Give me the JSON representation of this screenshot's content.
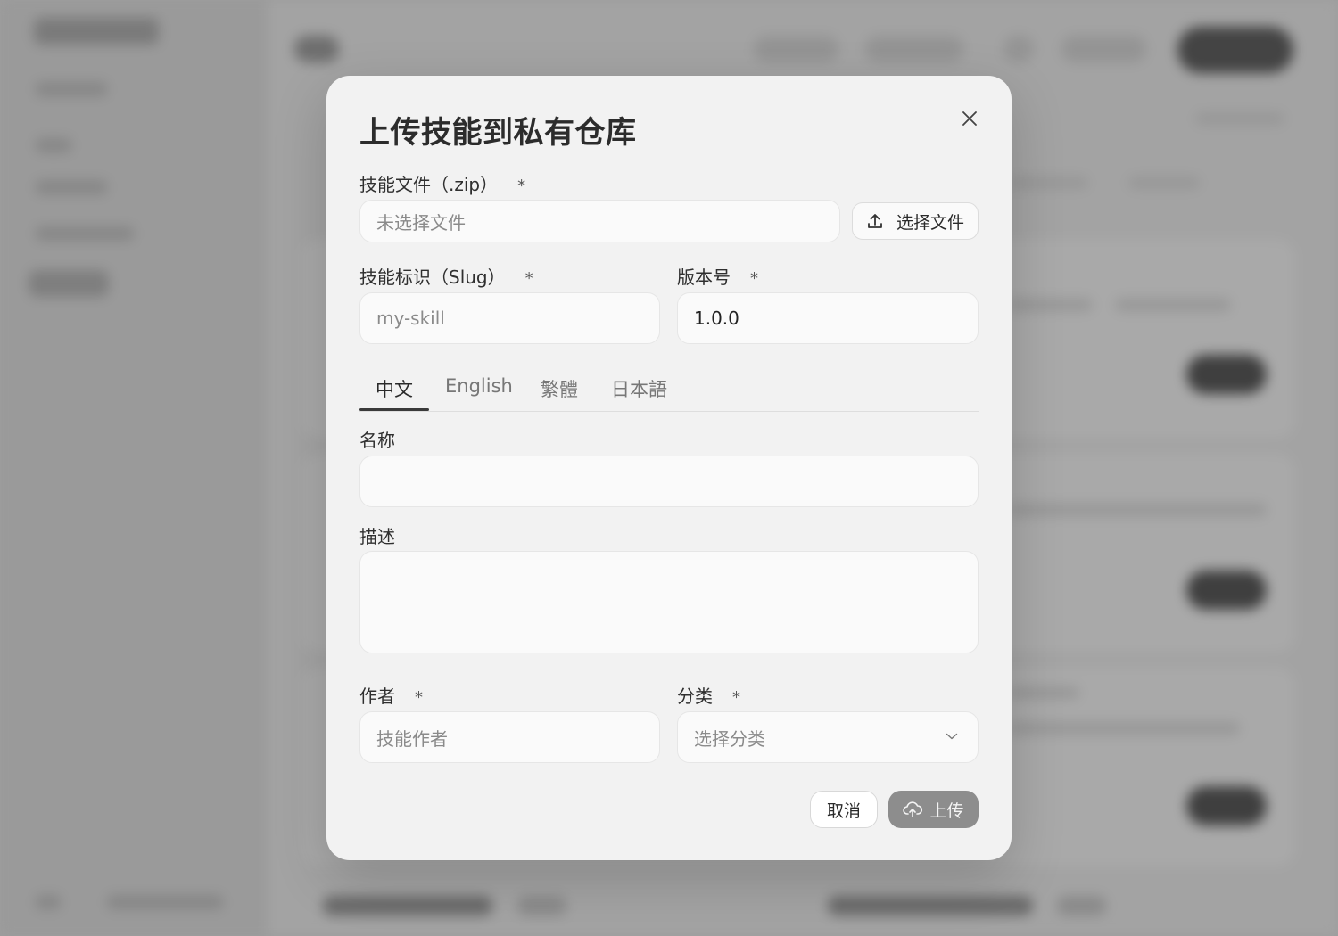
{
  "modal": {
    "title": "上传技能到私有仓库",
    "required_mark": "*",
    "file": {
      "label": "技能文件（.zip）",
      "placeholder": "未选择文件",
      "button_label": "选择文件"
    },
    "slug": {
      "label": "技能标识（Slug）",
      "placeholder": "my-skill"
    },
    "version": {
      "label": "版本号",
      "value": "1.0.0"
    },
    "tabs": [
      {
        "label": "中文"
      },
      {
        "label": "English"
      },
      {
        "label": "繁體"
      },
      {
        "label": "日本語"
      }
    ],
    "active_tab": "中文",
    "name": {
      "label": "名称",
      "value": ""
    },
    "description": {
      "label": "描述",
      "value": ""
    },
    "author": {
      "label": "作者",
      "placeholder": "技能作者"
    },
    "category": {
      "label": "分类",
      "placeholder": "选择分类"
    },
    "actions": {
      "cancel_label": "取消",
      "upload_label": "上传"
    }
  },
  "icons": {
    "close": "close-icon",
    "upload_file": "upload-icon",
    "chevron": "chevron-down-icon",
    "cloud_upload": "cloud-upload-icon"
  },
  "colors": {
    "overlay": "#9d9d9d",
    "modal_bg": "#f2f2f2",
    "input_bg": "#fafafa",
    "upload_button": "#8d8d8d",
    "tab_active": "#2a2a2a"
  }
}
